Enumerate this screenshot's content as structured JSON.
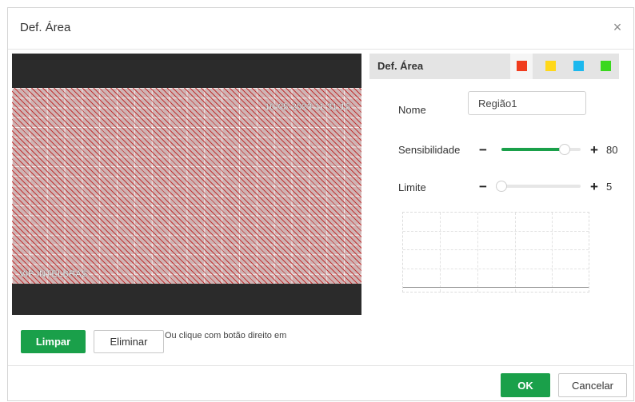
{
  "dialog": {
    "title": "Def. Área",
    "close_icon": "×"
  },
  "preview": {
    "timestamp": "10-05-2023 11:31:15",
    "camera_name": "VIP INTELBRAS"
  },
  "area_panel": {
    "header_label": "Def. Área",
    "colors": [
      {
        "name": "red",
        "hex": "#f03c1e",
        "selected": true
      },
      {
        "name": "yellow",
        "hex": "#ffd81a",
        "selected": false
      },
      {
        "name": "blue",
        "hex": "#1cb8ee",
        "selected": false
      },
      {
        "name": "green",
        "hex": "#3ad81e",
        "selected": false
      }
    ],
    "name_label": "Nome",
    "name_value": "Região1",
    "sensitivity_label": "Sensibilidade",
    "sensitivity_minus": "−",
    "sensitivity_plus": "+",
    "sensitivity_value": "80",
    "sensitivity_level": 0.8,
    "threshold_label": "Limite",
    "threshold_minus": "−",
    "threshold_plus": "+",
    "threshold_value": "5",
    "threshold_level": 0.0
  },
  "actions": {
    "clear_label": "Limpar",
    "delete_label": "Eliminar",
    "hint_text": "Ou clique com botão direito em"
  },
  "footer": {
    "ok_label": "OK",
    "cancel_label": "Cancelar"
  }
}
